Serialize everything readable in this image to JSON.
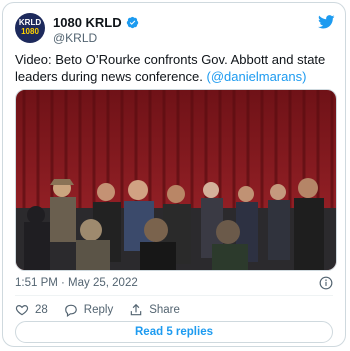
{
  "account": {
    "display_name": "1080 KRLD",
    "handle": "@KRLD",
    "avatar_text_line1": "KRLD",
    "avatar_text_line2": "1080"
  },
  "tweet": {
    "text_main": "Video: Beto O’Rourke confronts Gov. Abbott and state leaders during news conference.",
    "mention": "(@danielmarans)",
    "time": "1:51 PM · May 25, 2022"
  },
  "actions": {
    "like_count": "28",
    "reply_label": "Reply",
    "share_label": "Share"
  },
  "read_replies_label": "Read 5 replies",
  "icons": {
    "twitter_bird": "twitter-bird-icon",
    "verified": "verified-badge-icon",
    "info": "info-icon",
    "heart": "heart-icon",
    "reply": "reply-icon",
    "share": "share-icon"
  },
  "colors": {
    "accent": "#1d9bf0",
    "muted": "#536471",
    "border": "#cfd9de",
    "curtain": "#8e1d22"
  }
}
